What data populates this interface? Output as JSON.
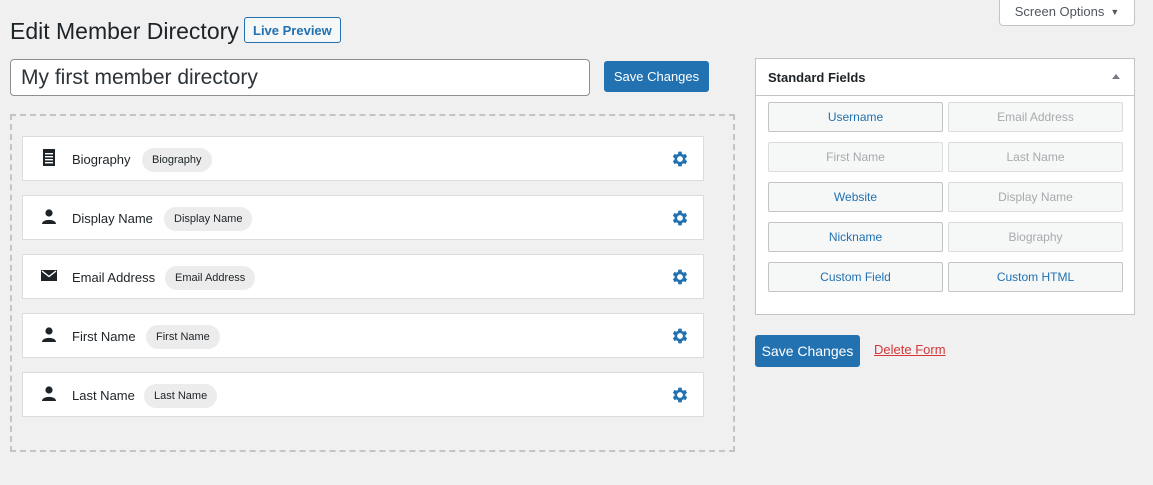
{
  "header": {
    "title": "Edit Member Directory",
    "live_preview": "Live Preview",
    "screen_options": "Screen Options"
  },
  "form": {
    "title_value": "My first member directory",
    "save_label": "Save Changes"
  },
  "fields": [
    {
      "label": "Biography",
      "tag": "Biography",
      "icon": "document-icon"
    },
    {
      "label": "Display Name",
      "tag": "Display Name",
      "icon": "user-icon"
    },
    {
      "label": "Email Address",
      "tag": "Email Address",
      "icon": "envelope-icon"
    },
    {
      "label": "First Name",
      "tag": "First Name",
      "icon": "user-icon"
    },
    {
      "label": "Last Name",
      "tag": "Last Name",
      "icon": "user-icon"
    }
  ],
  "sidebar": {
    "panel_title": "Standard Fields",
    "buttons": [
      {
        "label": "Username",
        "enabled": true
      },
      {
        "label": "Email Address",
        "enabled": false
      },
      {
        "label": "First Name",
        "enabled": false
      },
      {
        "label": "Last Name",
        "enabled": false
      },
      {
        "label": "Website",
        "enabled": true
      },
      {
        "label": "Display Name",
        "enabled": false
      },
      {
        "label": "Nickname",
        "enabled": true
      },
      {
        "label": "Biography",
        "enabled": false
      },
      {
        "label": "Custom Field",
        "enabled": true
      },
      {
        "label": "Custom HTML",
        "enabled": true
      }
    ],
    "save_label": "Save Changes",
    "delete_label": "Delete Form"
  },
  "colors": {
    "accent": "#2271b1",
    "danger": "#d63638",
    "background": "#f0f0f1"
  }
}
